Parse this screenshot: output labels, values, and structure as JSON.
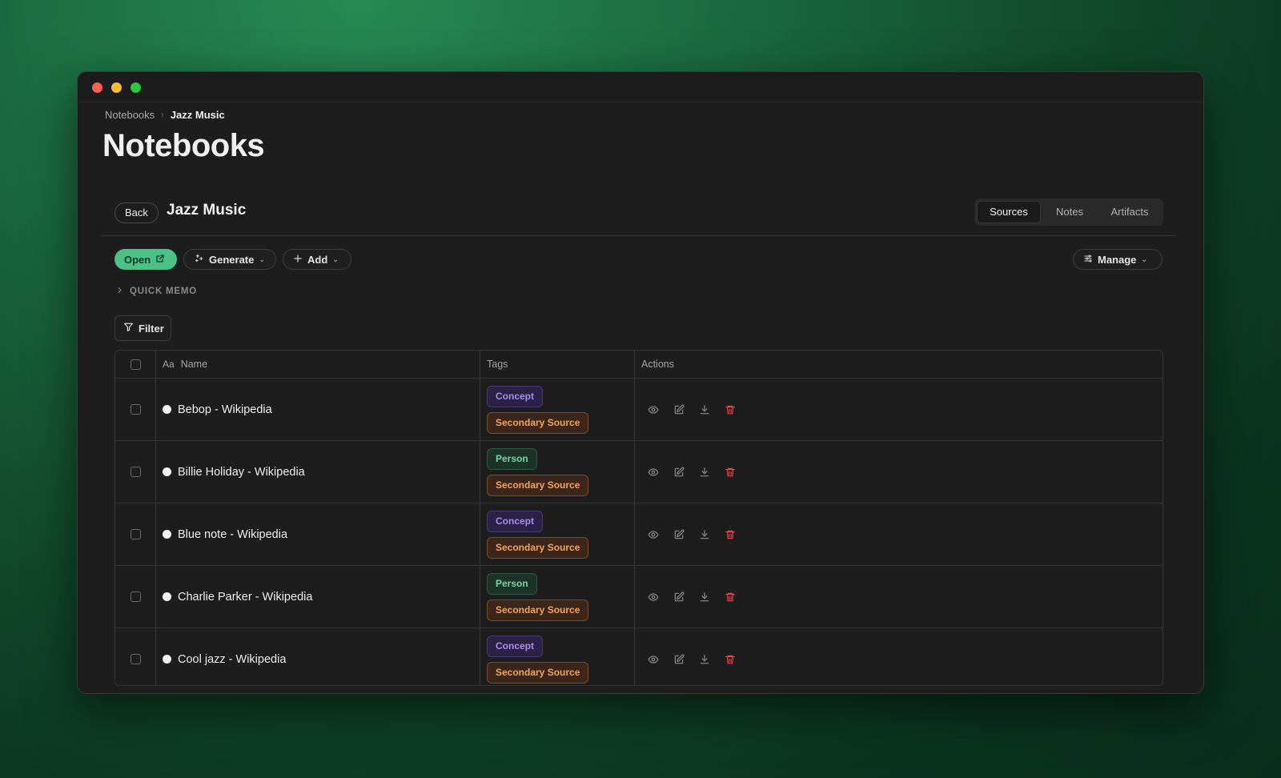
{
  "breadcrumb": {
    "root": "Notebooks",
    "current": "Jazz Music"
  },
  "page_title": "Notebooks",
  "notebook": {
    "back_label": "Back",
    "name": "Jazz Music"
  },
  "tabs": [
    {
      "label": "Sources",
      "active": true
    },
    {
      "label": "Notes",
      "active": false
    },
    {
      "label": "Artifacts",
      "active": false
    }
  ],
  "toolbar": {
    "open_label": "Open",
    "generate_label": "Generate",
    "add_label": "Add",
    "manage_label": "Manage"
  },
  "quick_memo_label": "QUICK MEMO",
  "filter_label": "Filter",
  "table": {
    "columns": {
      "name_prefix": "Aa",
      "name": "Name",
      "tags": "Tags",
      "actions": "Actions"
    },
    "rows": [
      {
        "name": "Bebop - Wikipedia",
        "tags": [
          "Concept",
          "Secondary Source"
        ]
      },
      {
        "name": "Billie Holiday - Wikipedia",
        "tags": [
          "Person",
          "Secondary Source"
        ]
      },
      {
        "name": "Blue note - Wikipedia",
        "tags": [
          "Concept",
          "Secondary Source"
        ]
      },
      {
        "name": "Charlie Parker - Wikipedia",
        "tags": [
          "Person",
          "Secondary Source"
        ]
      },
      {
        "name": "Cool jazz - Wikipedia",
        "tags": [
          "Concept",
          "Secondary Source"
        ]
      }
    ]
  },
  "icons": {
    "open": "external-link-icon",
    "generate": "sparkles-icon",
    "add": "plus-icon",
    "manage": "sliders-icon",
    "quick_memo": "chevron-right-icon",
    "filter": "funnel-icon",
    "actions": [
      "eye-icon",
      "edit-icon",
      "download-icon",
      "trash-icon"
    ]
  },
  "colors": {
    "accent": "#4bc188",
    "concept": "#a98cf0",
    "person": "#6fd8a2",
    "secondary_source": "#f0a460",
    "delete": "#e5484d"
  }
}
